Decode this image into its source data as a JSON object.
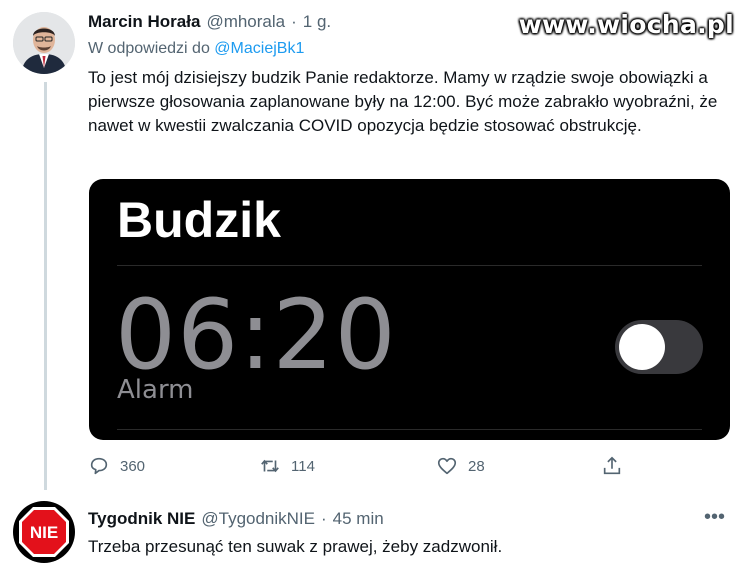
{
  "watermark": "www.wiocha.pl",
  "tweets": [
    {
      "author_name": "Marcin Horała",
      "handle": "@mhorala",
      "separator": "·",
      "time": "1 g.",
      "reply_prefix": "W odpowiedzi do",
      "reply_to": "@MaciejBk1",
      "text": "To jest mój dzisiejszy budzik Panie redaktorze. Mamy w rządzie swoje obowiązki a pierwsze głosowania zaplanowane były na 12:00. Być może zabrakło wyobraźni, że nawet w kwestii zwalczania COVID opozycja będzie stosować obstrukcję.",
      "media": {
        "title": "Budzik",
        "alarm_time": "06:20",
        "alarm_label": "Alarm",
        "toggle_on": false
      },
      "actions": {
        "replies": "360",
        "retweets": "114",
        "likes": "28"
      }
    },
    {
      "author_name": "Tygodnik NIE",
      "handle": "@TygodnikNIE",
      "separator": "·",
      "time": "45 min",
      "text": "Trzeba przesunąć ten suwak z prawej, żeby zadzwonił.",
      "avatar_text": "NIE",
      "more_label": "•••"
    }
  ],
  "colors": {
    "link": "#1d9bf0",
    "secondary_text": "#536471",
    "alarm_bg": "#000000",
    "nie_red": "#e3111b"
  }
}
